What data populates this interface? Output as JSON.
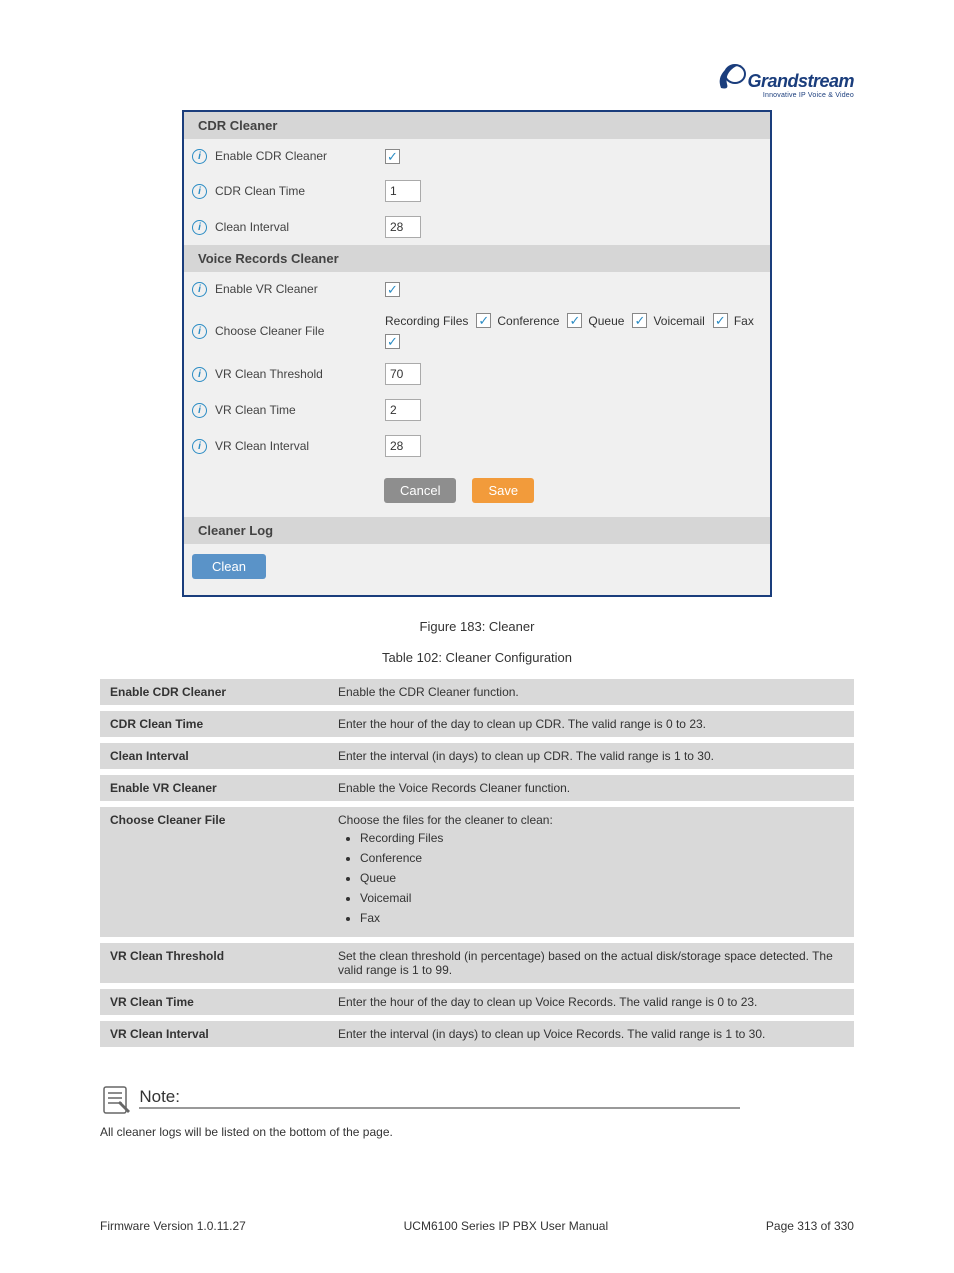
{
  "logo": {
    "brand": "Grandstream",
    "tagline": "Innovative IP Voice & Video"
  },
  "panel": {
    "cdr": {
      "header": "CDR Cleaner",
      "enable": {
        "label": "Enable CDR Cleaner",
        "checked": true
      },
      "clean_time": {
        "label": "CDR Clean Time",
        "value": "1"
      },
      "clean_interval": {
        "label": "Clean Interval",
        "value": "28"
      }
    },
    "vr": {
      "header": "Voice Records Cleaner",
      "enable": {
        "label": "Enable VR Cleaner",
        "checked": true
      },
      "choose_file": {
        "label": "Choose Cleaner File",
        "options": [
          {
            "label": "Recording Files",
            "checked": true
          },
          {
            "label": "Conference",
            "checked": true
          },
          {
            "label": "Queue",
            "checked": true
          },
          {
            "label": "Voicemail",
            "checked": true
          },
          {
            "label": "Fax",
            "checked": true
          }
        ]
      },
      "threshold": {
        "label": "VR Clean Threshold",
        "value": "70"
      },
      "clean_time": {
        "label": "VR Clean Time",
        "value": "2"
      },
      "clean_interval": {
        "label": "VR Clean Interval",
        "value": "28"
      }
    },
    "buttons": {
      "cancel": "Cancel",
      "save": "Save"
    },
    "log": {
      "header": "Cleaner Log",
      "clean": "Clean"
    }
  },
  "figure_caption": "Figure 183: Cleaner",
  "table_caption": "Table 102: Cleaner Configuration",
  "spec": [
    {
      "k": "Enable CDR Cleaner",
      "v": "Enable the CDR Cleaner function."
    },
    {
      "k": "CDR Clean Time",
      "v": "Enter the hour of the day to clean up CDR. The valid range is 0 to 23."
    },
    {
      "k": "Clean Interval",
      "v": "Enter the interval (in days) to clean up CDR. The valid range is 1 to 30."
    },
    {
      "k": "Enable VR Cleaner",
      "v": "Enable the Voice Records Cleaner function."
    },
    {
      "k": "Choose Cleaner File",
      "v_intro": "Choose the files for the cleaner to clean:",
      "v_list": [
        "Recording Files",
        "Conference",
        "Queue",
        "Voicemail",
        "Fax"
      ]
    },
    {
      "k": "VR Clean Threshold",
      "v": "Set the clean threshold (in percentage) based on the actual disk/storage space detected. The valid range is 1 to 99."
    },
    {
      "k": "VR Clean Time",
      "v": "Enter the hour of the day to clean up Voice Records. The valid range is 0 to 23."
    },
    {
      "k": "VR Clean Interval",
      "v": "Enter the interval (in days) to clean up Voice Records. The valid range is 1 to 30."
    }
  ],
  "note": {
    "icon_label": "Note:",
    "body": "All cleaner logs will be listed on the bottom of the page."
  },
  "footer": {
    "left": "Firmware Version 1.0.11.27",
    "center": "UCM6100 Series IP PBX User Manual",
    "right": "Page 313 of 330"
  }
}
